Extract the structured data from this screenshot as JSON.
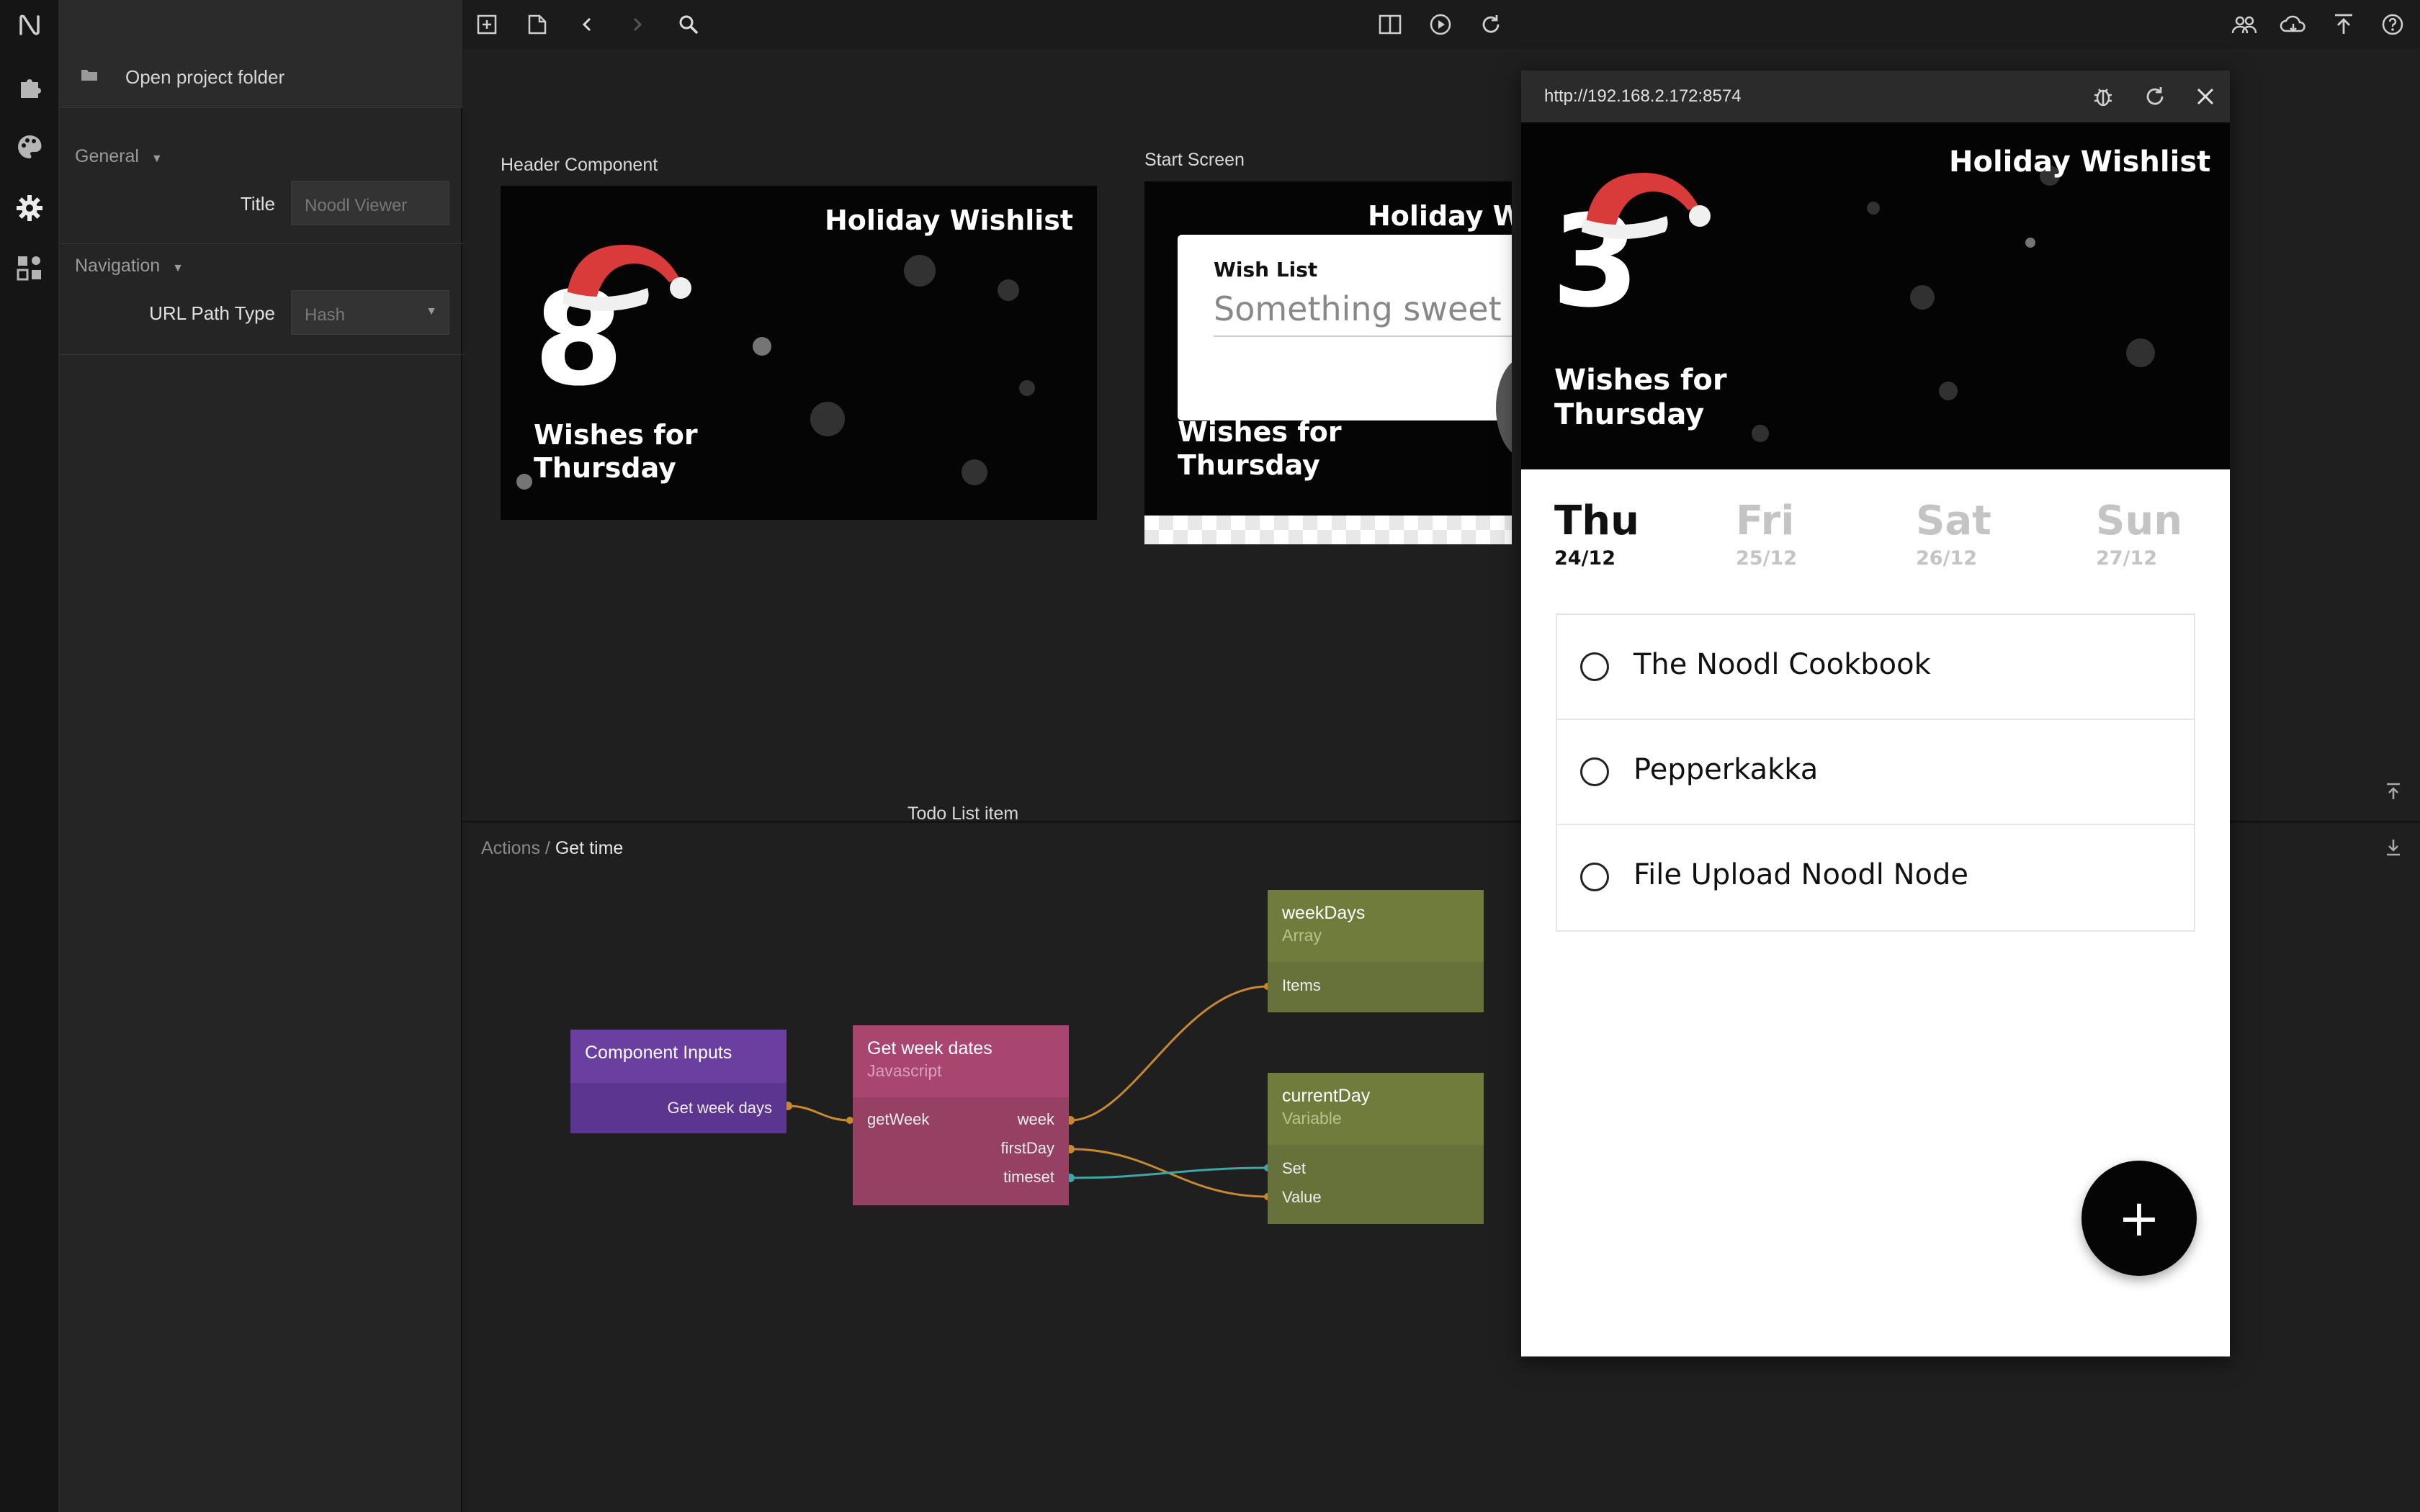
{
  "rail": {
    "icons": [
      "noodl-logo-icon",
      "puzzle-icon",
      "palette-icon",
      "gear-icon",
      "components-icon"
    ]
  },
  "settings": {
    "open_folder_label": "Open project folder",
    "general_label": "General",
    "title_label": "Title",
    "title_placeholder": "Noodl Viewer",
    "navigation_label": "Navigation",
    "url_path_type_label": "URL Path Type",
    "url_path_type_value": "Hash"
  },
  "toolbar": {
    "left_icons": [
      "add-icon",
      "new-page-icon",
      "back-icon",
      "forward-icon",
      "search-icon"
    ],
    "center_icons": [
      "split-view-icon",
      "play-icon",
      "refresh-icon"
    ],
    "right_icons": [
      "users-icon",
      "cloud-icon",
      "deploy-icon",
      "help-icon"
    ]
  },
  "canvas": {
    "header_component_label": "Header Component",
    "start_screen_label": "Start Screen",
    "todo_list_item_label": "Todo List item",
    "header_preview": {
      "title": "Holiday Wishlist",
      "count": "8",
      "wishes_line1": "Wishes for",
      "wishes_line2": "Thursday"
    },
    "start_preview": {
      "title": "Holiday Wi",
      "card_title": "Wish List",
      "card_input": "Something sweet",
      "wishes_line1": "Wishes for",
      "wishes_line2": "Thursday"
    }
  },
  "graph": {
    "breadcrumb_parent": "Actions / ",
    "breadcrumb_current": "Get time",
    "nodes": {
      "component_inputs": {
        "title": "Component Inputs",
        "port_out": "Get week days"
      },
      "get_week_dates": {
        "title": "Get week dates",
        "subtitle": "Javascript",
        "port_in": "getWeek",
        "port_week": "week",
        "port_first_day": "firstDay",
        "port_timeset": "timeset"
      },
      "week_days": {
        "title": "weekDays",
        "subtitle": "Array",
        "port_items": "Items"
      },
      "current_day": {
        "title": "currentDay",
        "subtitle": "Variable",
        "port_set": "Set",
        "port_value": "Value"
      }
    },
    "colors": {
      "component_inputs": "#6b3fa0",
      "get_week_dates": "#a8466f",
      "array_variable": "#6f7c3c",
      "wire_orange": "#c7892f",
      "wire_teal": "#3fa6a6"
    }
  },
  "viewer": {
    "url": "http://192.168.2.172:8574",
    "header": {
      "title": "Holiday Wishlist",
      "count": "3",
      "wishes_line1": "Wishes for",
      "wishes_line2": "Thursday"
    },
    "days": [
      {
        "name": "Thu",
        "date": "24/12",
        "active": true
      },
      {
        "name": "Fri",
        "date": "25/12",
        "active": false
      },
      {
        "name": "Sat",
        "date": "26/12",
        "active": false
      },
      {
        "name": "Sun",
        "date": "27/12",
        "active": false
      }
    ],
    "todos": [
      {
        "text": "The Noodl Cookbook"
      },
      {
        "text": "Pepperkakka"
      },
      {
        "text": "File Upload Noodl Node"
      }
    ],
    "fab_label": "+"
  }
}
